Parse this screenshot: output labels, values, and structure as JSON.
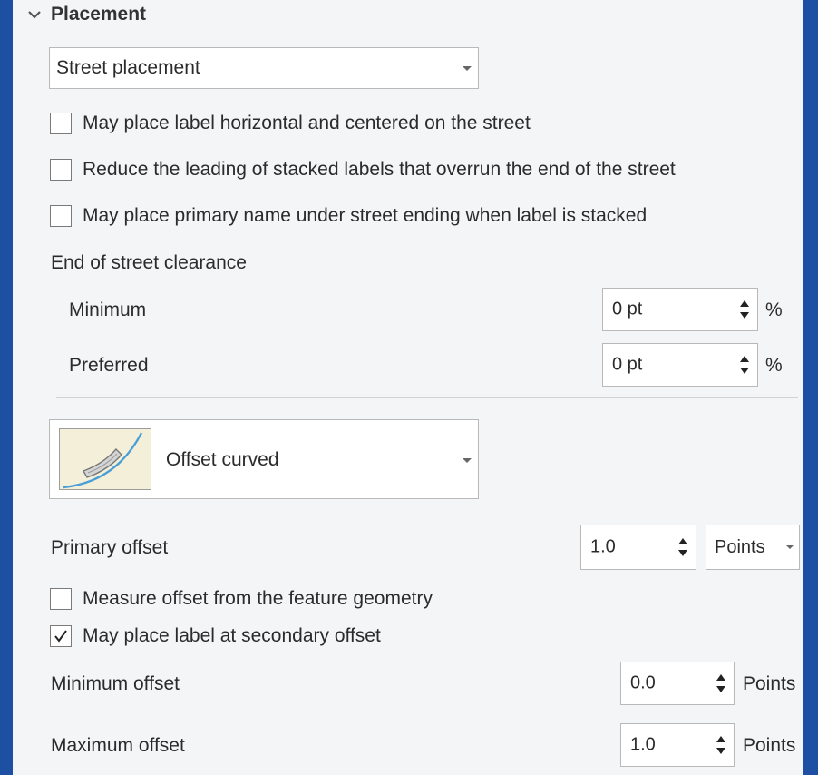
{
  "section": {
    "title": "Placement"
  },
  "placement_style": {
    "value": "Street placement"
  },
  "checkboxes": [
    {
      "label": "May place label horizontal and centered on the street",
      "checked": false
    },
    {
      "label": "Reduce the leading of stacked labels that overrun the end of the street",
      "checked": false
    },
    {
      "label": "May place primary name under street ending when label is stacked",
      "checked": false
    }
  ],
  "clearance": {
    "heading": "End of street clearance",
    "minimum": {
      "label": "Minimum",
      "value": "0 pt",
      "unit": "%"
    },
    "preferred": {
      "label": "Preferred",
      "value": "0 pt",
      "unit": "%"
    }
  },
  "offset_style": {
    "value": "Offset curved"
  },
  "primary_offset": {
    "label": "Primary offset",
    "value": "1.0",
    "unit": "Points"
  },
  "offset_checkboxes": [
    {
      "label": "Measure offset from the feature geometry",
      "checked": false
    },
    {
      "label": "May place label at secondary offset",
      "checked": true
    }
  ],
  "min_offset": {
    "label": "Minimum offset",
    "value": "0.0",
    "unit": "Points"
  },
  "max_offset": {
    "label": "Maximum offset",
    "value": "1.0",
    "unit": "Points"
  },
  "colors": {
    "frame": "#1d4fa3",
    "panel": "#f4f5f7",
    "curve": "#4a9fd8"
  }
}
